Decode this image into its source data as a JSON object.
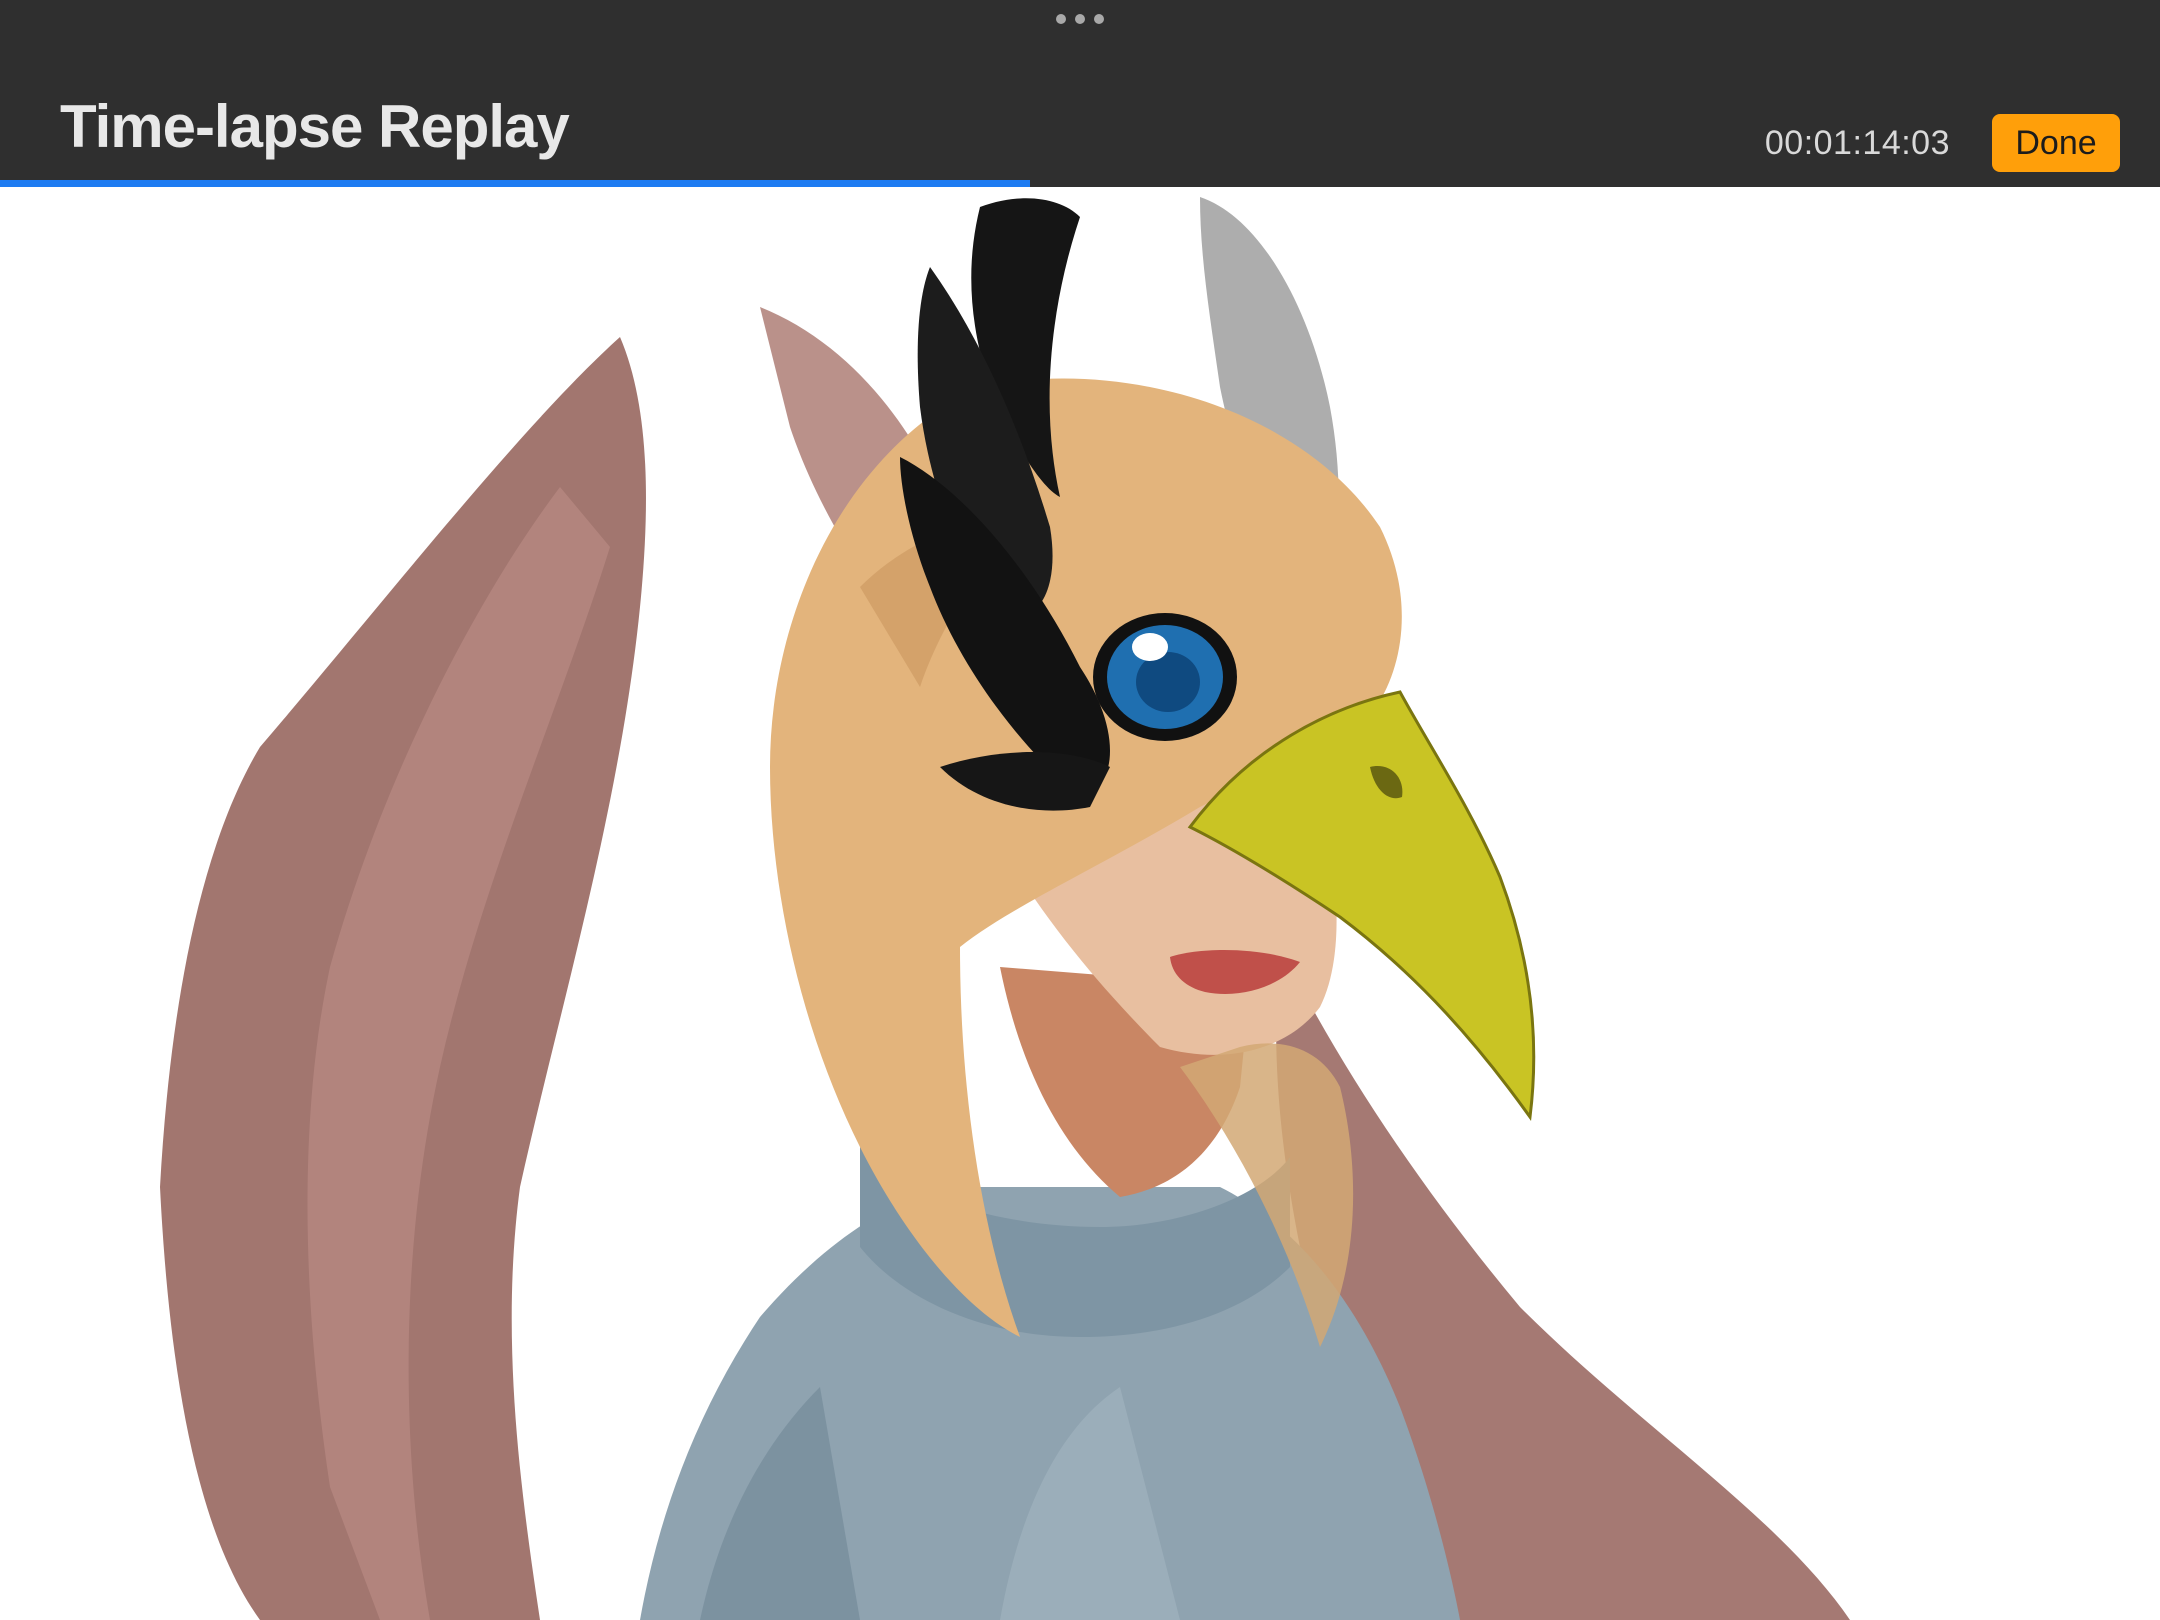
{
  "window": {
    "title": "Time-lapse Replay"
  },
  "playback": {
    "timecode": "00:01:14:03",
    "progress_fraction": 0.477
  },
  "actions": {
    "done_label": "Done"
  },
  "colors": {
    "toolbar_bg": "#2f2f2f",
    "accent_progress": "#1e7cf2",
    "done_button": "#ff9f0a"
  },
  "icons": {
    "grabber": "more-dots-icon"
  }
}
